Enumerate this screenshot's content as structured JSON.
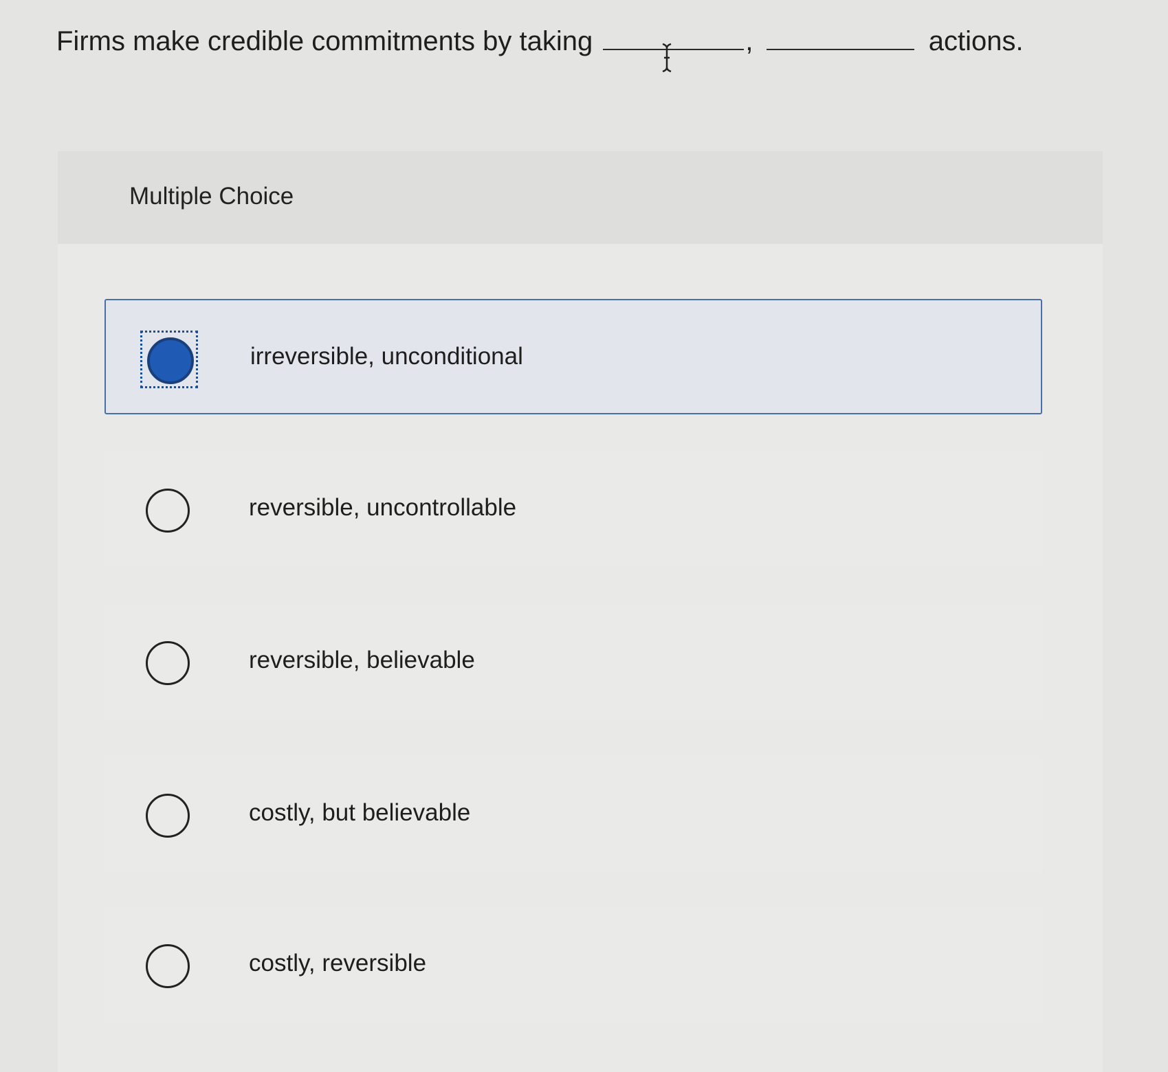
{
  "question": {
    "text_before": "Firms make credible commitments by taking",
    "separator": ",",
    "text_after": "actions."
  },
  "panel": {
    "label": "Multiple Choice"
  },
  "options": [
    {
      "label": "irreversible, unconditional",
      "selected": true
    },
    {
      "label": "reversible, uncontrollable",
      "selected": false
    },
    {
      "label": "reversible, believable",
      "selected": false
    },
    {
      "label": "costly, but believable",
      "selected": false
    },
    {
      "label": "costly, reversible",
      "selected": false
    }
  ],
  "colors": {
    "selected_radio": "#1f5bb4",
    "selected_border": "#4a6fa8",
    "background": "#e4e4e2"
  },
  "icons": {
    "cursor": "text-cursor-icon",
    "radio_selected": "radio-filled-icon",
    "radio_empty": "radio-empty-icon"
  }
}
